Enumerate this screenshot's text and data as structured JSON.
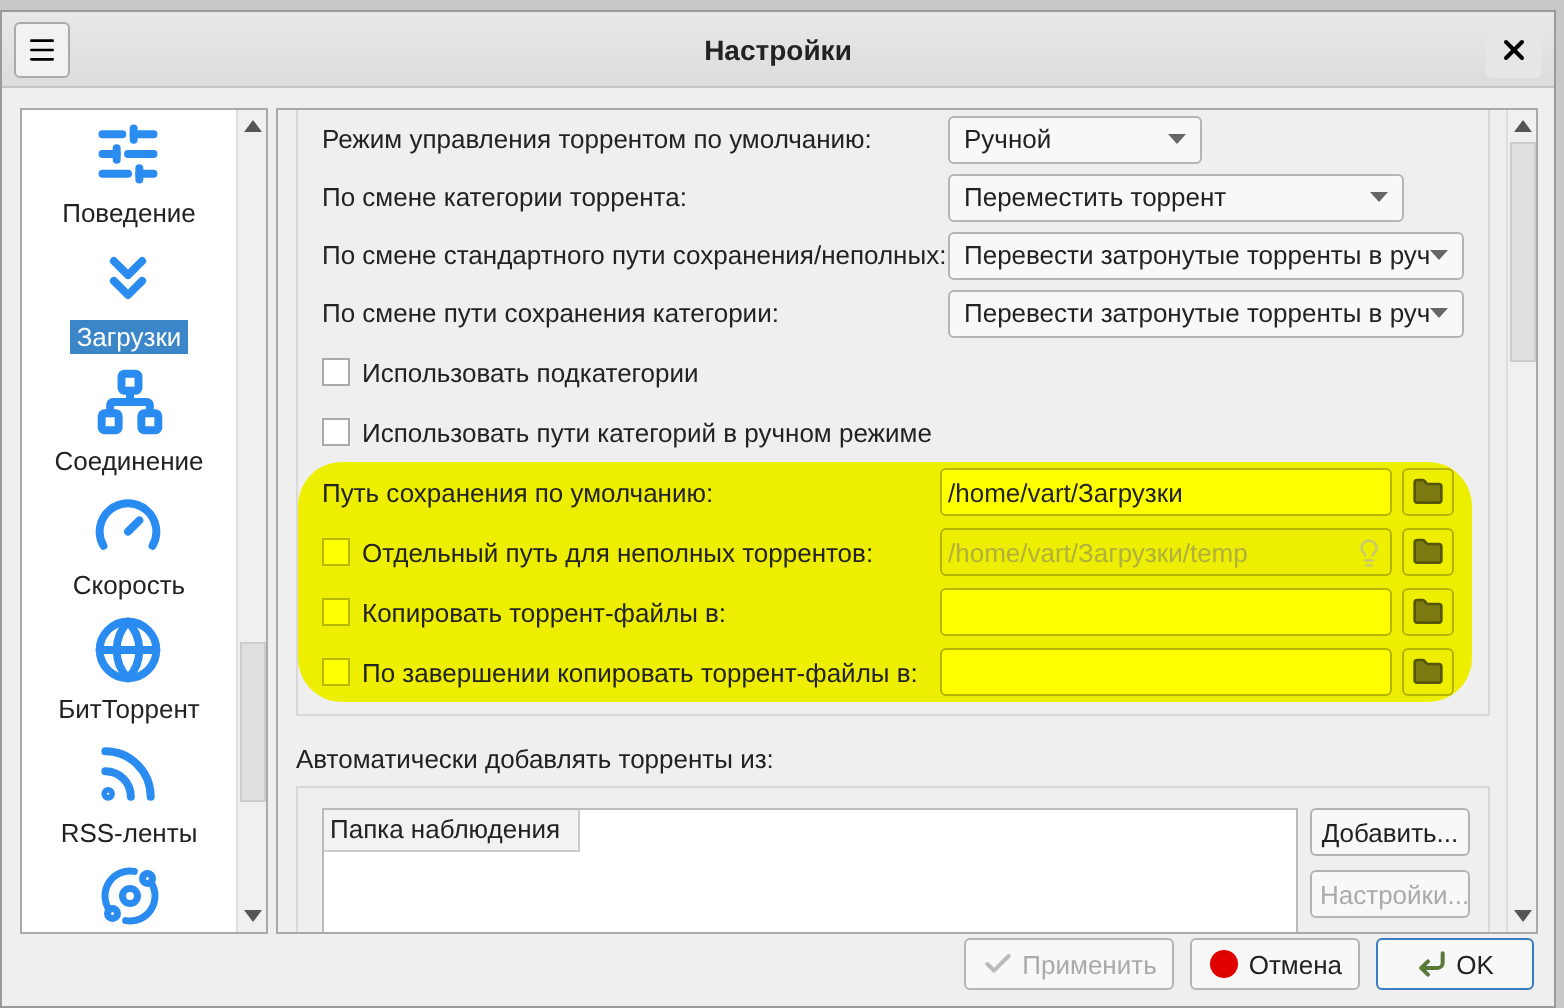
{
  "window": {
    "title": "Настройки"
  },
  "sidebar": {
    "items": [
      {
        "label": "Поведение",
        "selected": false,
        "kind": "sliders"
      },
      {
        "label": "Загрузки",
        "selected": true,
        "kind": "chevrons"
      },
      {
        "label": "Соединение",
        "selected": false,
        "kind": "network"
      },
      {
        "label": "Скорость",
        "selected": false,
        "kind": "gauge"
      },
      {
        "label": "БитТоррент",
        "selected": false,
        "kind": "globe"
      },
      {
        "label": "RSS-ленты",
        "selected": false,
        "kind": "rss"
      }
    ]
  },
  "rows": [
    {
      "kind": "combo",
      "label": "Режим управления торрентом по умолчанию:",
      "value": "Ручной"
    },
    {
      "kind": "combo",
      "label": "По смене категории торрента:",
      "value": "Переместить торрент"
    },
    {
      "kind": "combo",
      "label": "По смене стандартного пути сохранения/неполных:",
      "value": "Перевести затронутые торренты в руч"
    },
    {
      "kind": "combo",
      "label": "По смене пути сохранения категории:",
      "value": "Перевести затронутые торренты в руч"
    },
    {
      "kind": "checkbox",
      "label": "Использовать подкатегории",
      "checked": false
    },
    {
      "kind": "checkbox",
      "label": "Использовать пути категорий в ручном режиме",
      "checked": false
    }
  ],
  "paths": [
    {
      "label": "Путь сохранения по умолчанию:",
      "value": "/home/vart/Загрузки",
      "has_checkbox": false,
      "disabled": false
    },
    {
      "label": "Отдельный путь для неполных торрентов:",
      "value": "/home/vart/Загрузки/temp",
      "has_checkbox": true,
      "checked": false,
      "disabled": true
    },
    {
      "label": "Копировать торрент-файлы в:",
      "has_checkbox": true,
      "checked": false,
      "disabled": false
    },
    {
      "label": "По завершении копировать торрент-файлы в:",
      "has_checkbox": true,
      "checked": false,
      "disabled": false
    }
  ],
  "watch": {
    "title": "Автоматически добавлять торренты из:",
    "column": "Папка наблюдения",
    "buttons": [
      {
        "label": "Добавить...",
        "disabled": false
      },
      {
        "label": "Настройки...",
        "disabled": true
      }
    ]
  },
  "footer": {
    "buttons": [
      {
        "label": "Применить",
        "kind": "apply",
        "disabled": true,
        "default": false
      },
      {
        "label": "Отмена",
        "kind": "cancel",
        "disabled": false,
        "default": false
      },
      {
        "label": "OK",
        "kind": "ok",
        "disabled": false,
        "default": true
      }
    ]
  }
}
